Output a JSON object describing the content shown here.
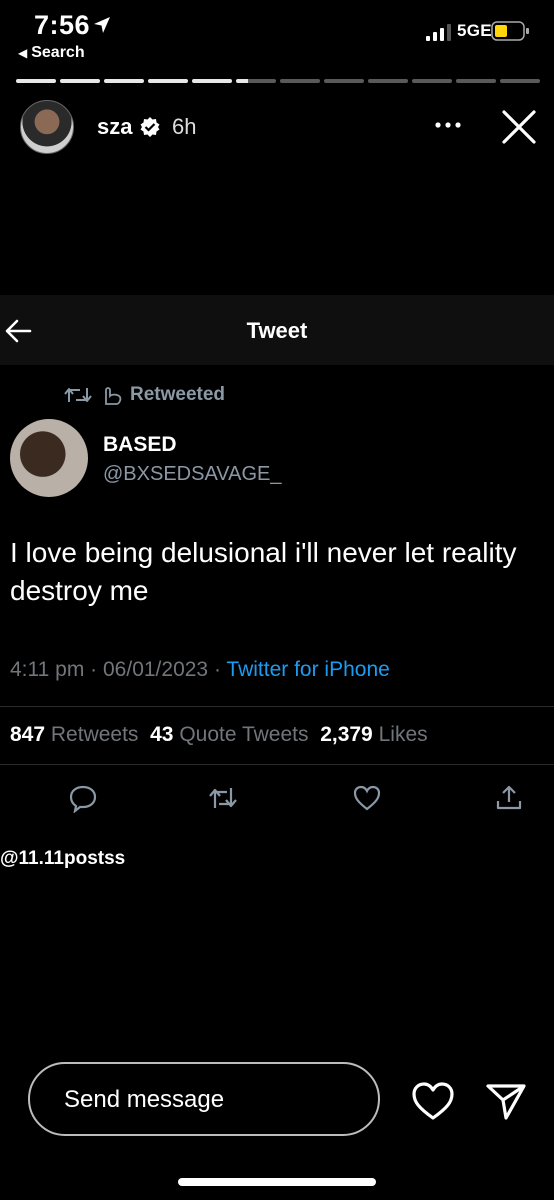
{
  "status_bar": {
    "time": "7:56",
    "back_label": "Search",
    "network": "5GE"
  },
  "story": {
    "progress": {
      "segments_total": 12,
      "segments_done": 5,
      "current_fraction": 0.3
    },
    "username": "sza",
    "age": "6h"
  },
  "tweet": {
    "header_title": "Tweet",
    "retweet_label": "Retweeted",
    "author_name": "BASED",
    "author_handle": "@BXSEDSAVAGE_",
    "text": "I love being delusional i'll never let reality destroy me",
    "time": "4:11 pm",
    "date": "06/01/2023",
    "source": "Twitter for iPhone",
    "stats": {
      "retweets_count": "847",
      "retweets_label": "Retweets",
      "quotes_count": "43",
      "quotes_label": "Quote Tweets",
      "likes_count": "2,379",
      "likes_label": "Likes"
    }
  },
  "watermark": "@11.11postss",
  "bottom_bar": {
    "message_placeholder": "Send message"
  },
  "colors": {
    "link_blue": "#1d9bf0",
    "muted": "#71767b",
    "background": "#000000"
  }
}
